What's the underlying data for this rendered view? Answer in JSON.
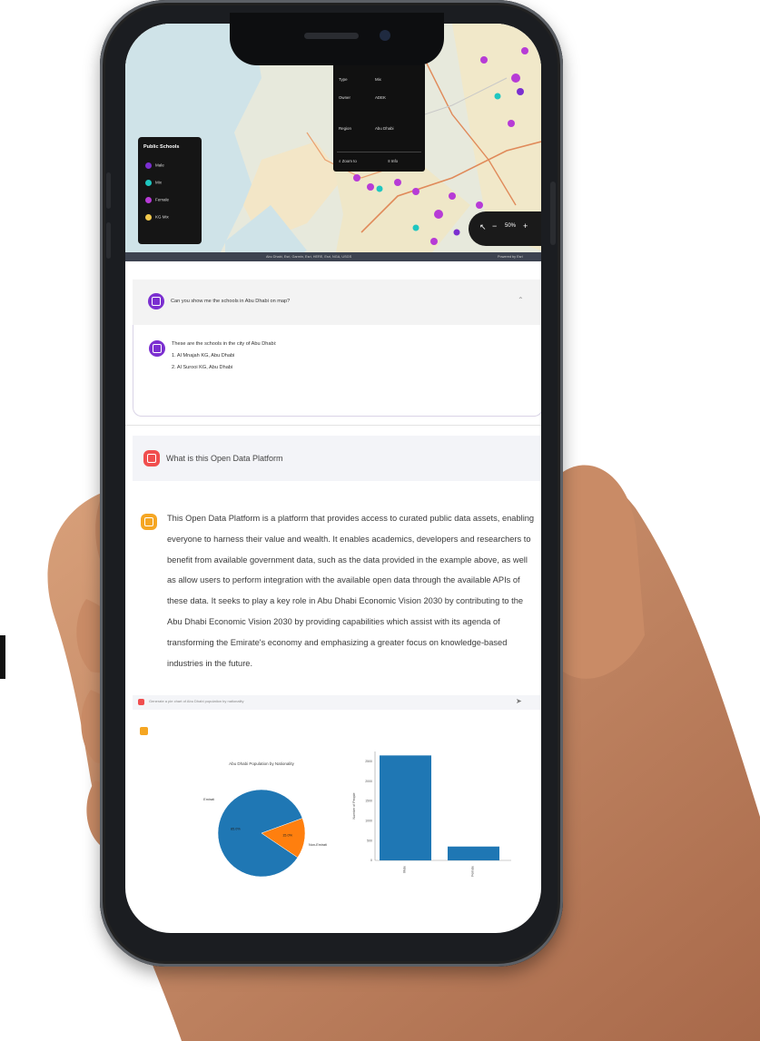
{
  "colors": {
    "purple": "#7b2fd0",
    "teal": "#1fc6c0",
    "magenta": "#b73bd6",
    "yellow": "#f2c94c",
    "red_icon": "#f04e4e",
    "orange_icon": "#f5a623",
    "bar_blue": "#1f77b4",
    "pie_orange": "#ff7f0e"
  },
  "map": {
    "legend_title": "Public Schools",
    "legend_items": [
      "Male",
      "Mix",
      "Female",
      "KG Mix"
    ],
    "popup": {
      "rows": [
        {
          "label": "Type",
          "value": "Mix"
        },
        {
          "label": "Owner",
          "value": "ADEK"
        },
        {
          "label": "Region",
          "value": "Abu Dhabi"
        }
      ],
      "footer_left": "Zoom to",
      "footer_right": "Info"
    },
    "zoom_controls": {
      "minus": "−",
      "plus": "+",
      "level": "50%"
    },
    "attribution": "Abu Dhabi, Esri, Garmin, Esri, HERE, Esri, NGA, USGS",
    "attribution_right": "Powered by Esri"
  },
  "chat": {
    "question1": "Can you show me the schools in Abu Dhabi on map?",
    "answer1_intro": "These are the schools in the city of Abu Dhabi:",
    "answer1_list": [
      "1. Al Mnajah KG, Abu Dhabi",
      "2. Al Surooi KG, Abu Dhabi"
    ],
    "question2": "What is this Open Data Platform",
    "answer2": "This Open Data Platform is a platform that provides access to curated public data assets, enabling everyone to harness their value and wealth. It enables academics, developers and researchers to benefit from available government data, such as the data provided in the example above, as well as allow users to perform integration with the available open data through the available APIs of these data. It seeks to play a key role in Abu Dhabi Economic Vision 2030 by contributing to the Abu Dhabi Economic Vision 2030 by providing capabilities which assist with its agenda of transforming the Emirate's economy and emphasizing a greater focus on knowledge-based industries in the future.",
    "search_placeholder": "Generate a pie chart of Abu Dhabi population by nationality"
  },
  "chart_data": [
    {
      "type": "pie",
      "title": "Abu Dhabi Population by Nationality",
      "labels": [
        "Emirati",
        "Non-Emirati"
      ],
      "values": [
        85,
        15
      ],
      "slice_labels": [
        "85.0%",
        "15.0%"
      ]
    },
    {
      "type": "bar",
      "categories": [
        "Male",
        "Female"
      ],
      "values": [
        2650,
        350
      ],
      "ylabel": "Number of People",
      "ylim": [
        0,
        2750
      ],
      "yticks": [
        0,
        500,
        1000,
        1500,
        2000,
        2500
      ]
    }
  ]
}
